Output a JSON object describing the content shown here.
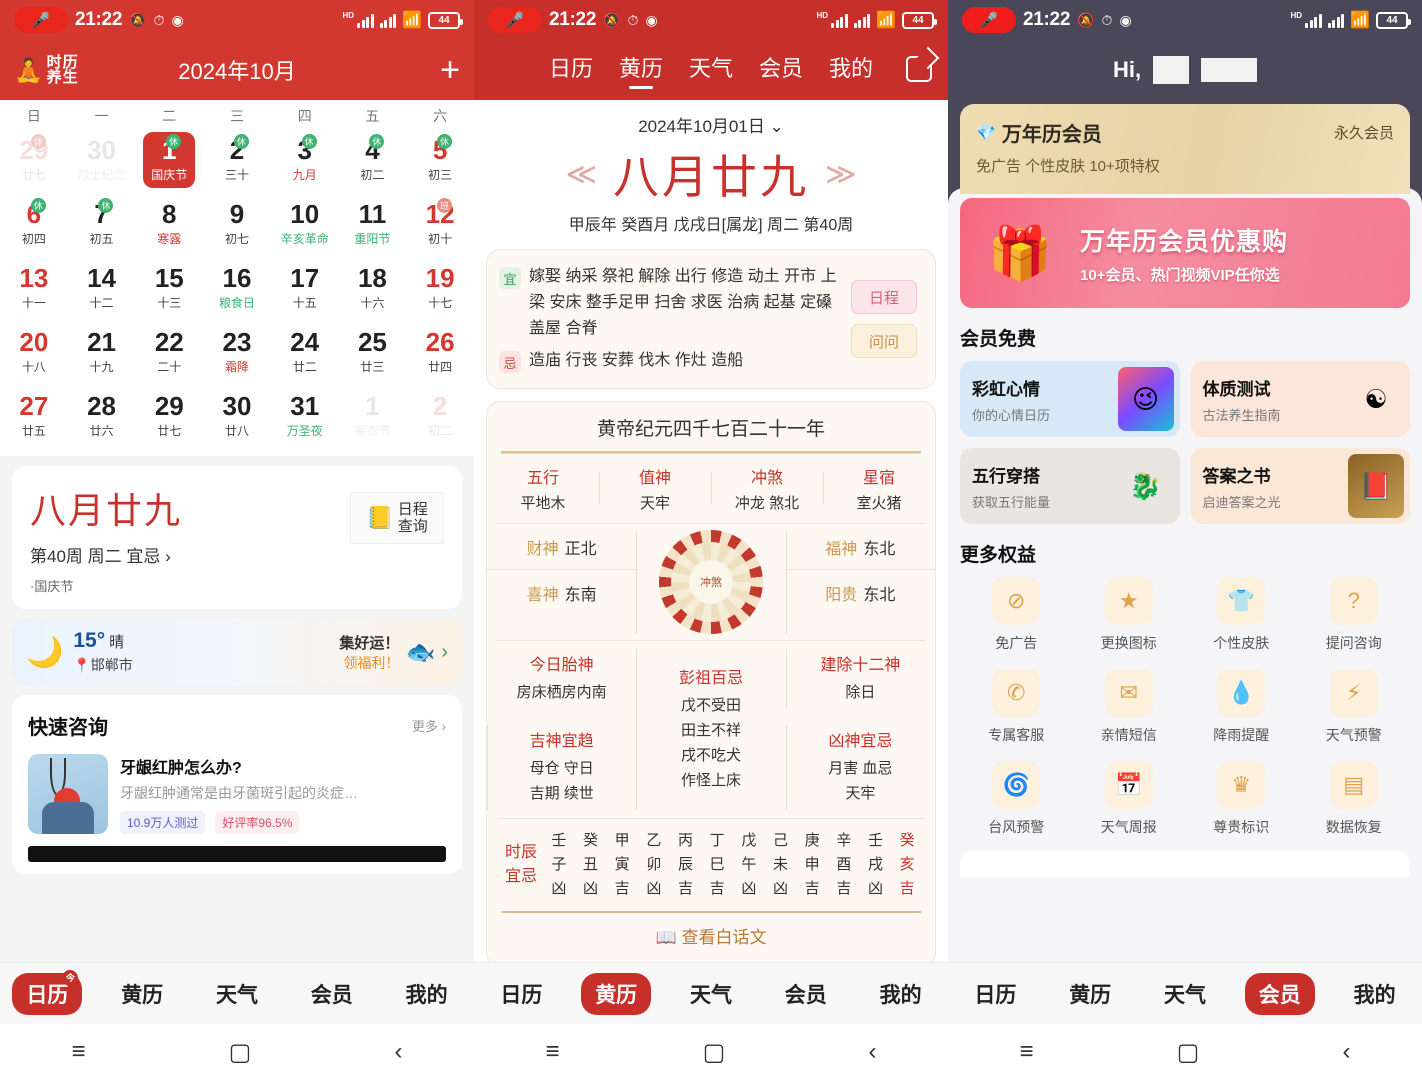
{
  "status_bar": {
    "time": "21:22",
    "battery": "44",
    "hd": "HD",
    "mic_icon": "mic-icon",
    "mute_icon": "mute-icon"
  },
  "screen1": {
    "logo_text_top": "时历",
    "logo_text_bottom": "养生",
    "title": "2024年10月",
    "add_label": "+",
    "weekdays": [
      "日",
      "一",
      "二",
      "三",
      "四",
      "五",
      "六"
    ],
    "days": [
      {
        "num": "29",
        "lun": "廿七",
        "out": true,
        "weekend": true,
        "badge": "休",
        "badge_type": "out"
      },
      {
        "num": "30",
        "lun": "烈士纪念",
        "out": true
      },
      {
        "num": "1",
        "lun": "国庆节",
        "today": true,
        "badge": "休",
        "badge_type": "rest"
      },
      {
        "num": "2",
        "lun": "三十",
        "badge": "休",
        "badge_type": "rest"
      },
      {
        "num": "3",
        "lun": "九月",
        "lun_color": "red",
        "badge": "休",
        "badge_type": "rest"
      },
      {
        "num": "4",
        "lun": "初二",
        "badge": "休",
        "badge_type": "rest"
      },
      {
        "num": "5",
        "lun": "初三",
        "weekend": true,
        "badge": "休",
        "badge_type": "rest"
      },
      {
        "num": "6",
        "lun": "初四",
        "weekend": true,
        "badge": "休",
        "badge_type": "rest"
      },
      {
        "num": "7",
        "lun": "初五",
        "badge": "休",
        "badge_type": "rest"
      },
      {
        "num": "8",
        "lun": "寒露",
        "lun_color": "red"
      },
      {
        "num": "9",
        "lun": "初七"
      },
      {
        "num": "10",
        "lun": "辛亥革命",
        "lun_color": "green"
      },
      {
        "num": "11",
        "lun": "重阳节",
        "lun_color": "green"
      },
      {
        "num": "12",
        "lun": "初十",
        "weekend": true,
        "badge": "班",
        "badge_type": "work"
      },
      {
        "num": "13",
        "lun": "十一",
        "weekend": true
      },
      {
        "num": "14",
        "lun": "十二"
      },
      {
        "num": "15",
        "lun": "十三"
      },
      {
        "num": "16",
        "lun": "粮食日",
        "lun_color": "green"
      },
      {
        "num": "17",
        "lun": "十五"
      },
      {
        "num": "18",
        "lun": "十六"
      },
      {
        "num": "19",
        "lun": "十七",
        "weekend": true
      },
      {
        "num": "20",
        "lun": "十八",
        "weekend": true
      },
      {
        "num": "21",
        "lun": "十九"
      },
      {
        "num": "22",
        "lun": "二十"
      },
      {
        "num": "23",
        "lun": "霜降",
        "lun_color": "red"
      },
      {
        "num": "24",
        "lun": "廿二"
      },
      {
        "num": "25",
        "lun": "廿三"
      },
      {
        "num": "26",
        "lun": "廿四",
        "weekend": true
      },
      {
        "num": "27",
        "lun": "廿五",
        "weekend": true
      },
      {
        "num": "28",
        "lun": "廿六"
      },
      {
        "num": "29",
        "lun": "廿七"
      },
      {
        "num": "30",
        "lun": "廿八"
      },
      {
        "num": "31",
        "lun": "万圣夜",
        "lun_color": "green"
      },
      {
        "num": "1",
        "lun": "寒衣节",
        "out": true
      },
      {
        "num": "2",
        "lun": "初二",
        "out": true,
        "weekend": true
      }
    ],
    "lunar_card": {
      "lunar": "八月廿九",
      "sub": "第40周 周二 宜忌 ›",
      "festival": "·国庆节",
      "button_line1": "日程",
      "button_line2": "查询",
      "button_icon": "calendar-search-icon"
    },
    "weather": {
      "icon": "moon-icon",
      "temp": "15°",
      "cond": "晴",
      "pin_icon": "location-pin-icon",
      "city": "邯郸市",
      "lucky_line1": "集好运！",
      "lucky_line2": "领福利！",
      "fish_icon": "koi-fish-icon",
      "chevron": "›"
    },
    "quick": {
      "title": "快速咨询",
      "more": "更多 ›",
      "item": {
        "heading": "牙龈红肿怎么办?",
        "desc": "牙龈红肿通常是由牙菌斑引起的炎症…",
        "tag1": "10.9万人测过",
        "tag2": "好评率96.5%"
      }
    },
    "tabs": [
      {
        "label": "日历",
        "active": true,
        "badge": "今"
      },
      {
        "label": "黄历",
        "active": false
      },
      {
        "label": "天气",
        "active": false
      },
      {
        "label": "会员",
        "active": false
      },
      {
        "label": "我的",
        "active": false
      }
    ]
  },
  "screen2": {
    "tabs": [
      {
        "label": "日历",
        "active": false
      },
      {
        "label": "黄历",
        "active": true
      },
      {
        "label": "天气",
        "active": false
      },
      {
        "label": "会员",
        "active": false
      },
      {
        "label": "我的",
        "active": false
      }
    ],
    "share_icon": "share-icon",
    "date": "2024年10月01日 ⌄",
    "lunar_main": "八月廿九",
    "ganzhi": "甲辰年 癸酉月 戊戌日[属龙] 周二 第40周",
    "yi_mark": "宜",
    "yi_text": "嫁娶 纳采 祭祀 解除 出行 修造 动土 开市 上梁 安床 整手足甲 扫舍 求医 治病 起基 定磉 盖屋 合脊",
    "ji_mark": "忌",
    "ji_text": "造庙 行丧 安葬 伐木 作灶 造船",
    "btn_schedule": "日程",
    "btn_ask": "问问",
    "almanac_title": "黄帝纪元四千七百二十一年",
    "four": [
      {
        "k": "五行",
        "v": "平地木"
      },
      {
        "k": "值神",
        "v": "天牢"
      },
      {
        "k": "冲煞",
        "v": "冲龙 煞北"
      },
      {
        "k": "星宿",
        "v": "室火猪"
      }
    ],
    "gods": [
      {
        "k": "财神",
        "v": "正北"
      },
      {
        "k": "福神",
        "v": "东北"
      },
      {
        "k": "喜神",
        "v": "东南"
      },
      {
        "k": "阳贵",
        "v": "东北"
      }
    ],
    "wheel_label": "冲煞",
    "tri": [
      {
        "k": "今日胎神",
        "v": "房床栖房内南"
      },
      {
        "k": "彭祖百忌",
        "v": "戊不受田\n田主不祥\n戌不吃犬\n作怪上床"
      },
      {
        "k": "建除十二神",
        "v": "除日"
      },
      {
        "k": "吉神宜趋",
        "v": "母仓 守日\n吉期 续世"
      },
      {
        "k": "凶神宜忌",
        "v": "月害 血忌\n天牢"
      }
    ],
    "shichen_label_1": "时辰",
    "shichen_label_2": "宜忌",
    "shichen": [
      {
        "g": "壬",
        "z": "子",
        "v": "凶"
      },
      {
        "g": "癸",
        "z": "丑",
        "v": "凶"
      },
      {
        "g": "甲",
        "z": "寅",
        "v": "吉"
      },
      {
        "g": "乙",
        "z": "卯",
        "v": "凶"
      },
      {
        "g": "丙",
        "z": "辰",
        "v": "吉"
      },
      {
        "g": "丁",
        "z": "巳",
        "v": "吉"
      },
      {
        "g": "戊",
        "z": "午",
        "v": "凶"
      },
      {
        "g": "己",
        "z": "未",
        "v": "凶"
      },
      {
        "g": "庚",
        "z": "申",
        "v": "吉"
      },
      {
        "g": "辛",
        "z": "酉",
        "v": "吉"
      },
      {
        "g": "壬",
        "z": "戌",
        "v": "凶"
      },
      {
        "g": "癸",
        "z": "亥",
        "v": "吉",
        "red": true
      }
    ],
    "baihua_icon": "book-icon",
    "baihua": "查看白话文"
  },
  "screen3": {
    "greeting": "Hi,",
    "vip": {
      "diamond_icon": "diamond-icon",
      "title": "万年历会员",
      "status": "永久会员",
      "subtitle": "免广告 个性皮肤 10+项特权"
    },
    "banner": {
      "gift_icon": "gift-icon",
      "line1": "万年历会员优惠购",
      "line2": "10+会员、热门视频VIP任你选"
    },
    "free_title": "会员免费",
    "free_cards": [
      {
        "title": "彩虹心情",
        "sub": "你的心情日历",
        "art": "mood-emoji-icon",
        "style": "c-blue"
      },
      {
        "title": "体质测试",
        "sub": "古法养生指南",
        "art": "bagua-meditation-icon",
        "style": "c-peach"
      },
      {
        "title": "五行穿搭",
        "sub": "获取五行能量",
        "art": "dragon-coin-icon",
        "style": "c-grey"
      },
      {
        "title": "答案之书",
        "sub": "启迪答案之光",
        "art": "answer-book-icon",
        "style": "c-sand"
      }
    ],
    "rights_title": "更多权益",
    "rights": [
      {
        "label": "免广告",
        "icon": "no-ads-icon",
        "glyph": "⊘"
      },
      {
        "label": "更换图标",
        "icon": "app-icon-swap-icon",
        "glyph": "★"
      },
      {
        "label": "个性皮肤",
        "icon": "tshirt-skin-icon",
        "glyph": "👕"
      },
      {
        "label": "提问咨询",
        "icon": "question-bubble-icon",
        "glyph": "?"
      },
      {
        "label": "专属客服",
        "icon": "phone-support-icon",
        "glyph": "✆"
      },
      {
        "label": "亲情短信",
        "icon": "envelope-sms-icon",
        "glyph": "✉"
      },
      {
        "label": "降雨提醒",
        "icon": "raindrop-icon",
        "glyph": "💧"
      },
      {
        "label": "天气预警",
        "icon": "storm-cloud-icon",
        "glyph": "⚡"
      },
      {
        "label": "台风预警",
        "icon": "typhoon-icon",
        "glyph": "🌀"
      },
      {
        "label": "天气周报",
        "icon": "weather-report-icon",
        "glyph": "📅"
      },
      {
        "label": "尊贵标识",
        "icon": "crown-badge-icon",
        "glyph": "♛"
      },
      {
        "label": "数据恢复",
        "icon": "data-restore-icon",
        "glyph": "▤"
      }
    ],
    "tabs": [
      {
        "label": "日历",
        "active": false
      },
      {
        "label": "黄历",
        "active": false
      },
      {
        "label": "天气",
        "active": false
      },
      {
        "label": "会员",
        "active": true
      },
      {
        "label": "我的",
        "active": false
      }
    ]
  },
  "navbar": {
    "menu": "≡",
    "home": "▢",
    "back": "‹"
  }
}
